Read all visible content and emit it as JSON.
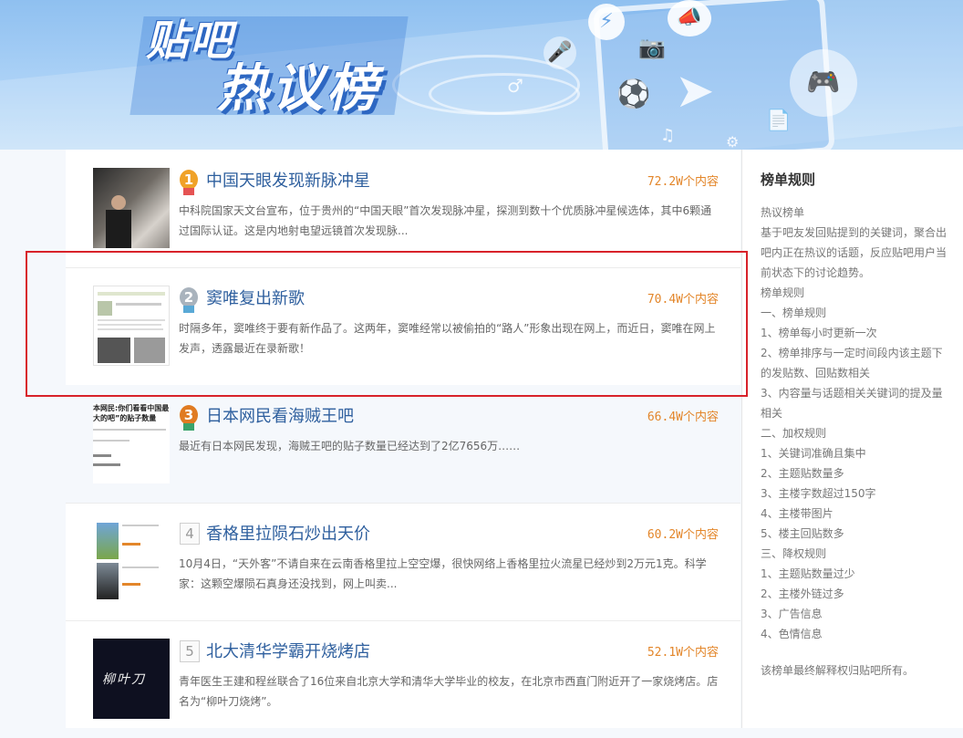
{
  "banner": {
    "title_line1": "贴吧",
    "title_line2": "热议榜"
  },
  "items": [
    {
      "rank": "1",
      "title": "中国天眼发现新脉冲星",
      "count": "72.2W个内容",
      "desc": "中科院国家天文台宣布，位于贵州的“中国天眼”首次发现脉冲星，探测到数十个优质脉冲星候选体，其中6颗通过国际认证。这是内地射电望远镜首次发现脉..."
    },
    {
      "rank": "2",
      "title": "窦唯复出新歌",
      "count": "70.4W个内容",
      "desc": "时隔多年，窦唯终于要有新作品了。这两年，窦唯经常以被偷拍的“路人”形象出现在网上，而近日，窦唯在网上发声，透露最近在录新歌！"
    },
    {
      "rank": "3",
      "title": "日本网民看海贼王吧",
      "count": "66.4W个内容",
      "desc": "最近有日本网民发现，海贼王吧的贴子数量已经达到了2亿7656万……",
      "thumb_text": "本网民:你们看看中国最大的吧”的贴子数量"
    },
    {
      "rank": "4",
      "title": "香格里拉陨石炒出天价",
      "count": "60.2W个内容",
      "desc": "10月4日，“天外客”不请自来在云南香格里拉上空空爆，很快网络上香格里拉火流星已经炒到2万元1克。科学家：这颗空爆陨石真身还没找到，网上叫卖..."
    },
    {
      "rank": "5",
      "title": "北大清华学霸开烧烤店",
      "count": "52.1W个内容",
      "desc": "青年医生王建和程丝联合了16位来自北京大学和清华大学毕业的校友，在北京市西直门附近开了一家烧烤店。店名为“柳叶刀烧烤”。",
      "thumb_text": "柳叶刀"
    }
  ],
  "sidebar": {
    "title": "榜单规则",
    "lines": [
      "热议榜单",
      "基于吧友发回贴提到的关键词，聚合出吧内正在热议的话题，反应贴吧用户当前状态下的讨论趋势。",
      "榜单规则",
      "一、榜单规则",
      "1、榜单每小时更新一次",
      "2、榜单排序与一定时间段内该主题下的发贴数、回贴数相关",
      "3、内容量与话题相关关键词的提及量相关",
      "二、加权规则",
      "1、关键词准确且集中",
      "2、主题贴数量多",
      "3、主楼字数超过150字",
      "4、主楼带图片",
      "5、楼主回贴数多",
      "三、降权规则",
      "1、主题贴数量过少",
      "2、主楼外链过多",
      "3、广告信息",
      "4、色情信息"
    ],
    "footer": "该榜单最终解释权归贴吧所有。"
  },
  "colors": {
    "title": "#2e5f9e",
    "count": "#e3862a",
    "highlight": "#d8222a",
    "gold": "#f0a228",
    "silver": "#a9b3bd",
    "bronze": "#e07b22"
  }
}
